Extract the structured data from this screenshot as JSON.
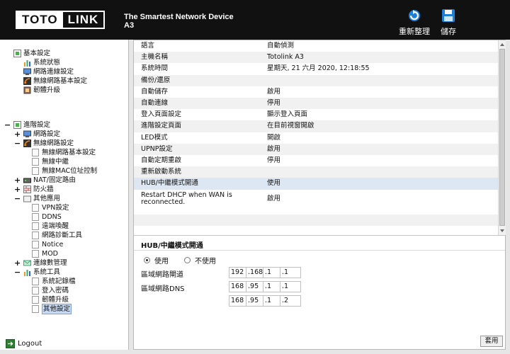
{
  "header": {
    "logo_left": "TOTO",
    "logo_right": "LINK",
    "tagline": "The Smartest Network Device",
    "model": "A3",
    "reboot_label": "重新整理",
    "save_label": "儲存"
  },
  "nav": {
    "basic_title": "基本設定",
    "basic_items": [
      "系統狀態",
      "網路連線設定",
      "無線網路基本設定",
      "韌體升級"
    ],
    "advanced_title": "進階設定",
    "network": "網路設定",
    "wireless": "無線網路設定",
    "wireless_items": [
      "無線網路基本設定",
      "無線中繼",
      "無線MAC位址控制"
    ],
    "nat": "NAT/固定路由",
    "firewall": "防火牆",
    "other_apps": "其他應用",
    "other_items": [
      "VPN設定",
      "DDNS",
      "遠端喚醒",
      "網路診斷工具",
      "Notice",
      "MOD"
    ],
    "data_mgmt": "連線數管理",
    "sys_tools": "系統工具",
    "tools_items": [
      "系統記錄檔",
      "登入密碼",
      "韌體升級",
      "其他設定"
    ],
    "logout": "Logout"
  },
  "settings_list": [
    {
      "label": "語言",
      "value": "自動偵測"
    },
    {
      "label": "主機名稱",
      "value": "Totolink A3"
    },
    {
      "label": "系統時間",
      "value": "星期天, 21 六月 2020, 12:18:55"
    },
    {
      "label": "備份/還原",
      "value": ""
    },
    {
      "label": "自動儲存",
      "value": "啟用"
    },
    {
      "label": "自動連線",
      "value": "停用"
    },
    {
      "label": "登入頁面設定",
      "value": "顯示登入頁面"
    },
    {
      "label": "進階設定頁面",
      "value": "在目前視窗開啟"
    },
    {
      "label": "LED模式",
      "value": "開啟"
    },
    {
      "label": "UPNP設定",
      "value": "啟用"
    },
    {
      "label": "自動定期重啟",
      "value": "停用"
    },
    {
      "label": "重新啟動系統",
      "value": ""
    },
    {
      "label": "HUB/中繼模式開通",
      "value": "使用"
    },
    {
      "label": "Restart DHCP when WAN is reconnected.",
      "value": "啟用"
    }
  ],
  "panel": {
    "title": "HUB/中繼模式開通",
    "option_use": "使用",
    "option_not_use": "不使用",
    "selected": "使用",
    "gateway_label": "區域網路閘道",
    "dns_label": "區域網路DNS",
    "gateway": [
      "192",
      ".168",
      ".1",
      ".1"
    ],
    "dns1": [
      "168",
      ".95",
      ".1",
      ".1"
    ],
    "dns2": [
      "168",
      ".95",
      ".1",
      ".2"
    ],
    "apply_label": "套用"
  },
  "icons": {
    "reboot": "refresh-icon",
    "save": "floppy-disk-icon",
    "logout": "logout-icon"
  },
  "colors": {
    "header_bg": "#111111",
    "accent_blue": "#1e7fd6",
    "selected_row": "#dde6f3"
  }
}
